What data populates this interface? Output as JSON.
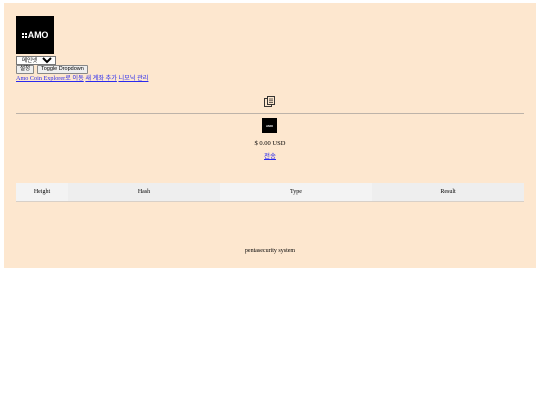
{
  "logo": {
    "text": "AMO"
  },
  "network_select": {
    "selected": "메인넷"
  },
  "buttons": {
    "settings": "설정",
    "toggle": "Toggle Dropdown"
  },
  "links": [
    {
      "label": "Amo Coin Explorer로 이동"
    },
    {
      "label": "새 계좌 추가"
    },
    {
      "label": "니모닉 관리"
    }
  ],
  "icons": {
    "copy": "copy-icon"
  },
  "wallet": {
    "logo_text": "AMO",
    "balance": "$ 0.00 USD",
    "send_label": "전송"
  },
  "table": {
    "headers": [
      "Height",
      "Hash",
      "Type",
      "Result"
    ]
  },
  "footer": {
    "text": "pentasecurity system"
  },
  "colors": {
    "panel_bg": "#fde7cf",
    "link": "#2a2aee",
    "logo_bg": "#000000"
  }
}
